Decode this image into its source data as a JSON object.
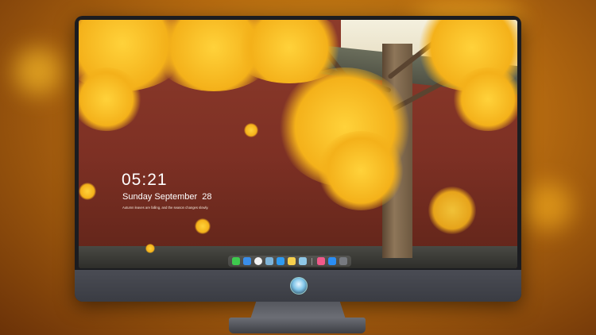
{
  "lockscreen": {
    "time": "05:21",
    "date": "Sunday September  28",
    "quote": "Autumn leaves are falling, and the season changes slowly."
  },
  "dock": {
    "icons": [
      {
        "name": "messages-icon",
        "color": "#3ec94e"
      },
      {
        "name": "finder-icon",
        "color": "#3a8eea"
      },
      {
        "name": "clock-icon",
        "color": "#f2f2f2"
      },
      {
        "name": "preview-icon",
        "color": "#7fb4d8"
      },
      {
        "name": "video-icon",
        "color": "#2f9bf0"
      },
      {
        "name": "notes-icon",
        "color": "#f6d04d"
      },
      {
        "name": "photos-icon",
        "color": "#8ec7e6"
      },
      {
        "name": "music-icon",
        "color": "#f05a8a"
      },
      {
        "name": "appstore-icon",
        "color": "#2b8ef5"
      },
      {
        "name": "camera-icon",
        "color": "#777a80"
      }
    ]
  },
  "colors": {
    "ginkgo_yellow": "#f4b11a",
    "wall_red": "#8d3b2b",
    "bezel": "#1b1c20"
  }
}
